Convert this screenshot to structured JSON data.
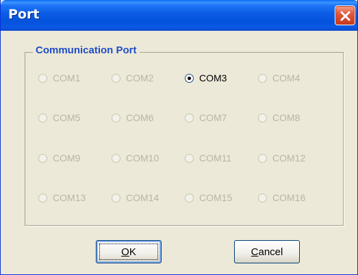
{
  "window": {
    "title": "Port"
  },
  "group": {
    "title": "Communication Port",
    "ports": [
      {
        "label": "COM1",
        "selected": false,
        "enabled": false
      },
      {
        "label": "COM2",
        "selected": false,
        "enabled": false
      },
      {
        "label": "COM3",
        "selected": true,
        "enabled": true
      },
      {
        "label": "COM4",
        "selected": false,
        "enabled": false
      },
      {
        "label": "COM5",
        "selected": false,
        "enabled": false
      },
      {
        "label": "COM6",
        "selected": false,
        "enabled": false
      },
      {
        "label": "COM7",
        "selected": false,
        "enabled": false
      },
      {
        "label": "COM8",
        "selected": false,
        "enabled": false
      },
      {
        "label": "COM9",
        "selected": false,
        "enabled": false
      },
      {
        "label": "COM10",
        "selected": false,
        "enabled": false
      },
      {
        "label": "COM11",
        "selected": false,
        "enabled": false
      },
      {
        "label": "COM12",
        "selected": false,
        "enabled": false
      },
      {
        "label": "COM13",
        "selected": false,
        "enabled": false
      },
      {
        "label": "COM14",
        "selected": false,
        "enabled": false
      },
      {
        "label": "COM15",
        "selected": false,
        "enabled": false
      },
      {
        "label": "COM16",
        "selected": false,
        "enabled": false
      }
    ]
  },
  "buttons": {
    "ok": {
      "mnemonic": "O",
      "rest": "K"
    },
    "cancel": {
      "mnemonic": "C",
      "rest": "ancel"
    }
  },
  "colors": {
    "title_bar": "#0553dd",
    "dialog_bg": "#ece9d8",
    "group_title": "#1f4cc6",
    "disabled_text": "#b8b5a5",
    "close_button": "#e15a3b"
  },
  "icons": {
    "close": "close-x-icon",
    "radio": "radio-button"
  }
}
